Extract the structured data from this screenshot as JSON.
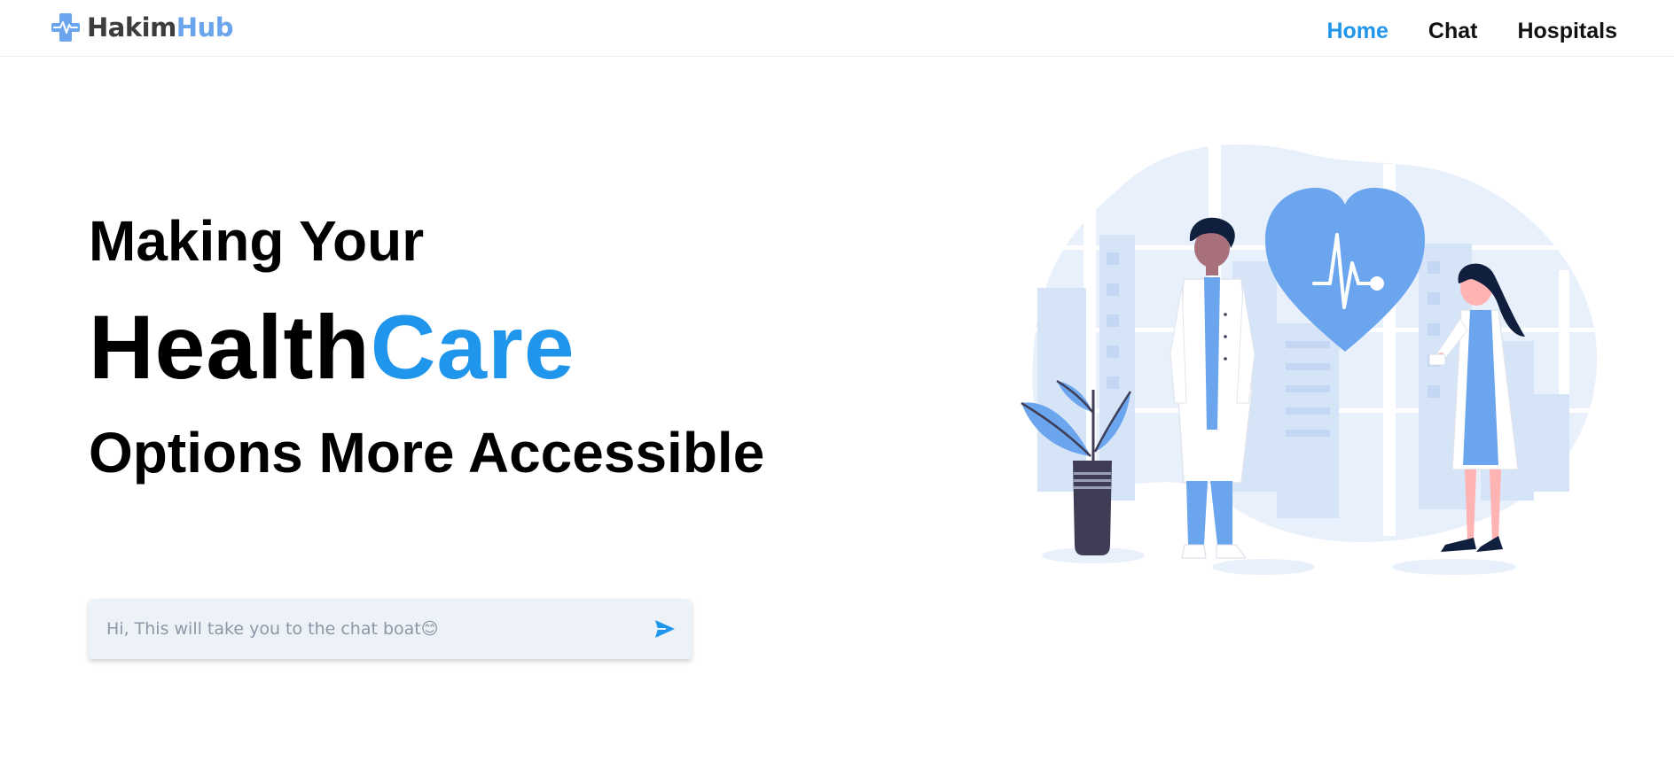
{
  "brand": {
    "name_part1": "Hakim",
    "name_part2": "Hub",
    "icon": "medical-cross-heartbeat-icon",
    "color_dark": "#3d3d3d",
    "color_accent": "#6aa5ee"
  },
  "nav": {
    "items": [
      {
        "label": "Home",
        "active": true
      },
      {
        "label": "Chat",
        "active": false
      },
      {
        "label": "Hospitals",
        "active": false
      }
    ],
    "active_color": "#1f95eb"
  },
  "hero": {
    "line1": "Making Your",
    "line2_part1": "Health",
    "line2_part2": "Care",
    "line3": "Options More Accessible",
    "accent_color": "#1f95eb"
  },
  "chat": {
    "placeholder": "Hi, This will take you to the chat boat😊",
    "send_icon": "send-icon"
  },
  "illustration": {
    "description_icon": "doctors-heart-illustration",
    "primary_color": "#6aa5ee",
    "background_color": "#e8f0fc"
  }
}
